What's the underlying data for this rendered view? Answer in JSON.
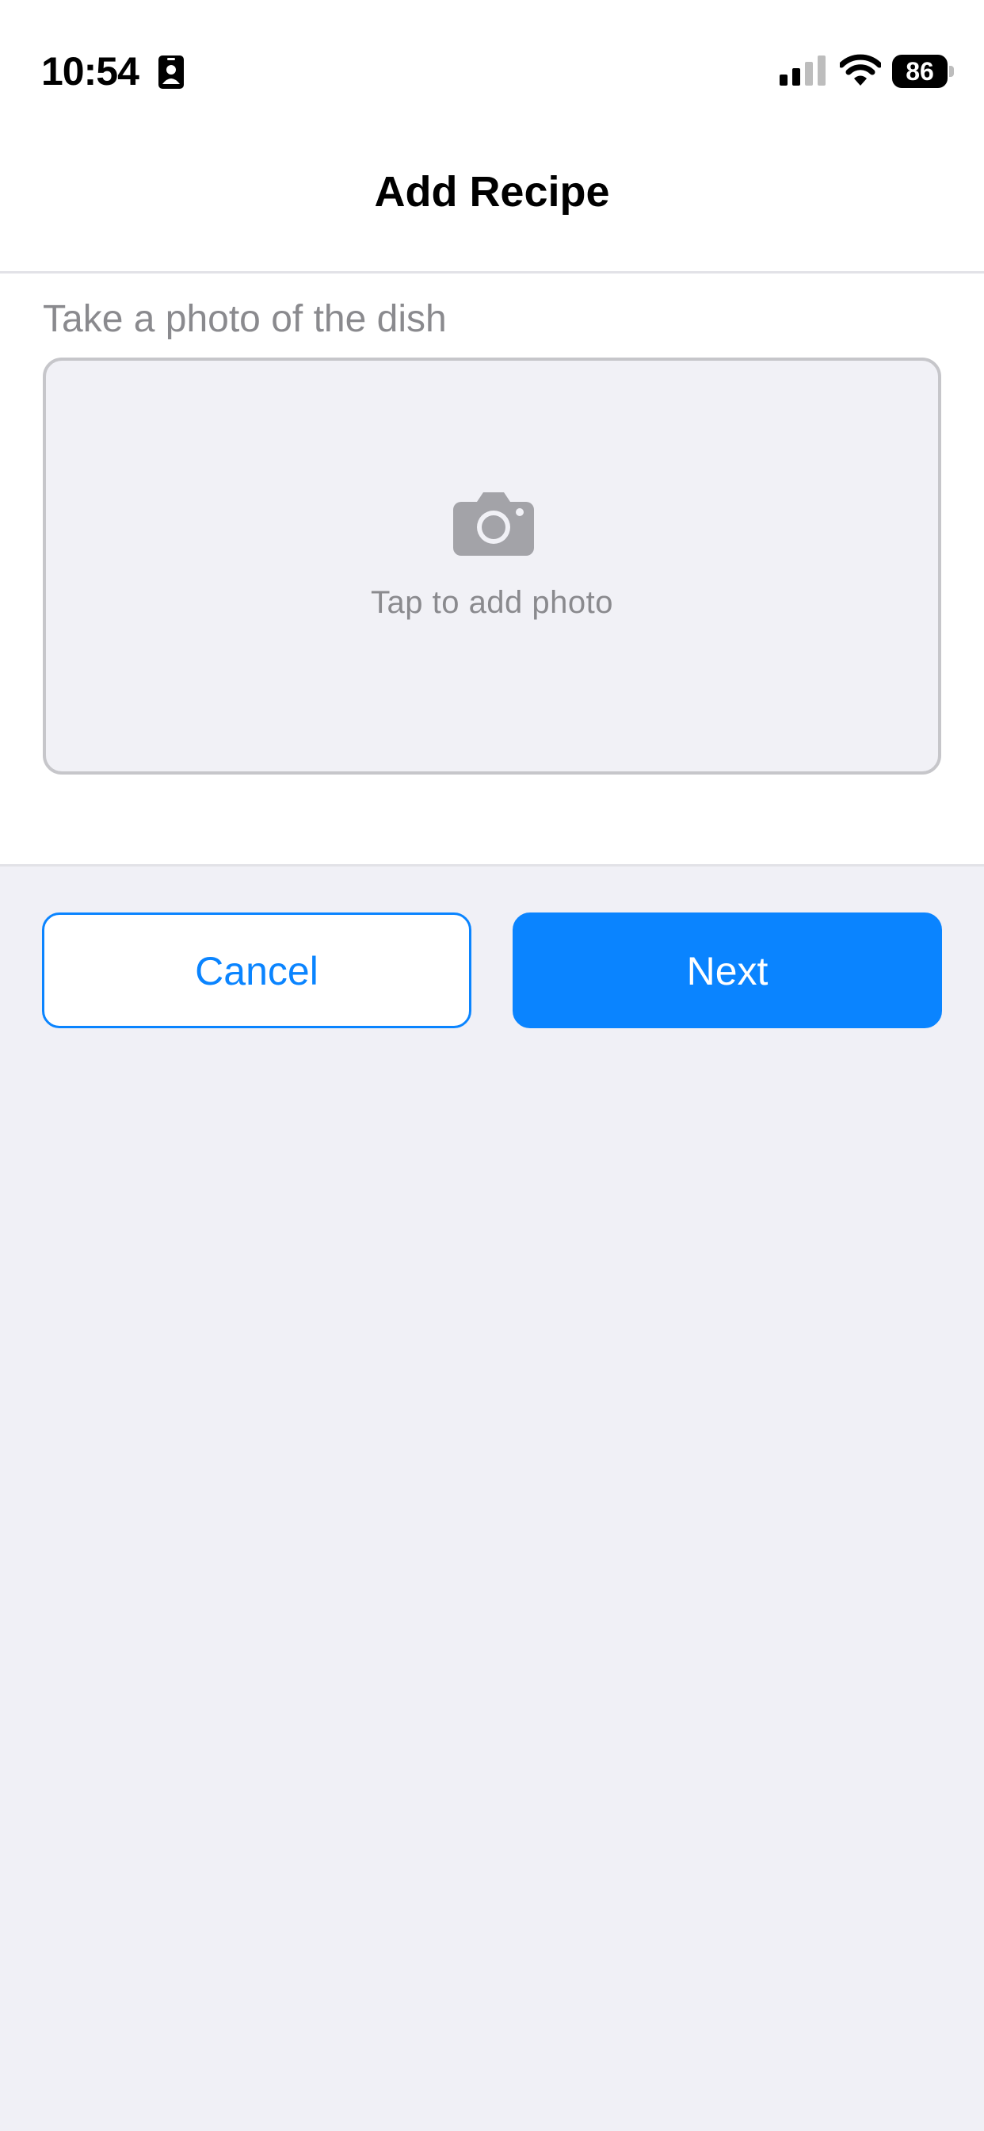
{
  "status_bar": {
    "time": "10:54",
    "battery_level": "86",
    "icons": [
      "id-card-icon",
      "cellular-signal-icon",
      "wifi-icon",
      "battery-icon"
    ]
  },
  "nav": {
    "title": "Add Recipe"
  },
  "photo": {
    "label": "Take a photo of the dish",
    "hint": "Tap to add photo",
    "icon": "camera-icon"
  },
  "actions": {
    "cancel_label": "Cancel",
    "next_label": "Next"
  },
  "colors": {
    "accent": "#0A84FF",
    "background": "#F0F0F6",
    "secondary_text": "#8A8A8E"
  }
}
